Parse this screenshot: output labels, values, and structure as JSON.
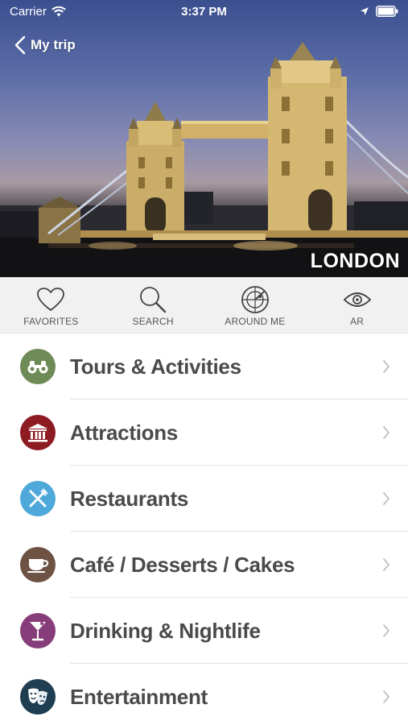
{
  "status_bar": {
    "carrier": "Carrier",
    "time": "3:37 PM"
  },
  "nav": {
    "back_label": "My trip"
  },
  "hero": {
    "city": "LONDON"
  },
  "tabs": [
    {
      "label": "FAVORITES",
      "icon": "heart-icon"
    },
    {
      "label": "SEARCH",
      "icon": "magnifier-icon"
    },
    {
      "label": "AROUND ME",
      "icon": "radar-icon"
    },
    {
      "label": "AR",
      "icon": "eye-icon"
    }
  ],
  "categories": [
    {
      "label": "Tours & Activities",
      "icon": "binoculars-icon",
      "color": "#6e8a56"
    },
    {
      "label": "Attractions",
      "icon": "museum-icon",
      "color": "#8e1b22"
    },
    {
      "label": "Restaurants",
      "icon": "fork-knife-icon",
      "color": "#4fa8da"
    },
    {
      "label": "Café / Desserts / Cakes",
      "icon": "coffee-cup-icon",
      "color": "#6e5345"
    },
    {
      "label": "Drinking & Nightlife",
      "icon": "cocktail-icon",
      "color": "#873d7a"
    },
    {
      "label": "Entertainment",
      "icon": "theater-masks-icon",
      "color": "#1f3e52"
    }
  ]
}
